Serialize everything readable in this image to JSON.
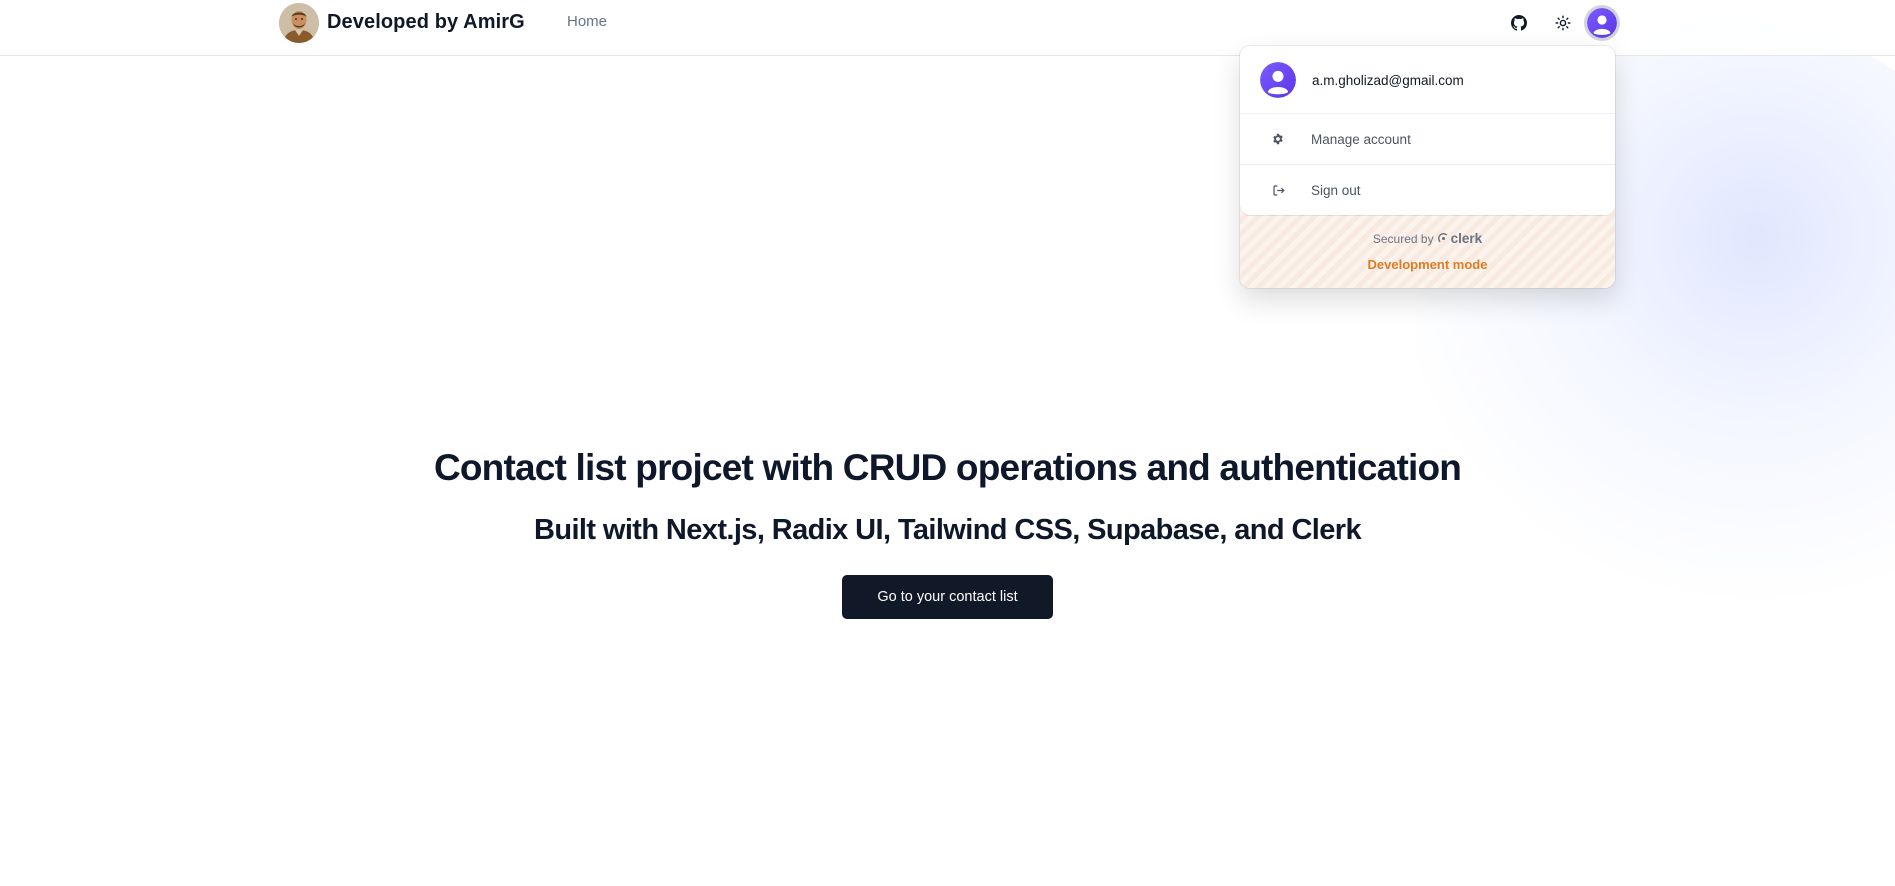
{
  "header": {
    "brand_title": "Developed by AmirG",
    "nav": {
      "home_label": "Home"
    },
    "icons": [
      "github-icon",
      "sun-icon",
      "user-avatar-icon"
    ]
  },
  "user_menu": {
    "email": "a.m.gholizad@gmail.com",
    "items": [
      {
        "label": "Manage account",
        "icon": "gear-icon"
      },
      {
        "label": "Sign out",
        "icon": "sign-out-icon"
      }
    ],
    "footer": {
      "secured_by": "Secured by",
      "provider": "clerk",
      "mode": "Development mode"
    }
  },
  "hero": {
    "title": "Contact list projcet with CRUD operations and authentication",
    "subtitle": "Built with Next.js, Radix UI, Tailwind CSS, Supabase, and Clerk",
    "cta_label": "Go to your contact list"
  },
  "colors": {
    "accent_purple": "#6c47ff",
    "dev_mode_orange": "#e07b24",
    "button_dark": "#111827"
  }
}
